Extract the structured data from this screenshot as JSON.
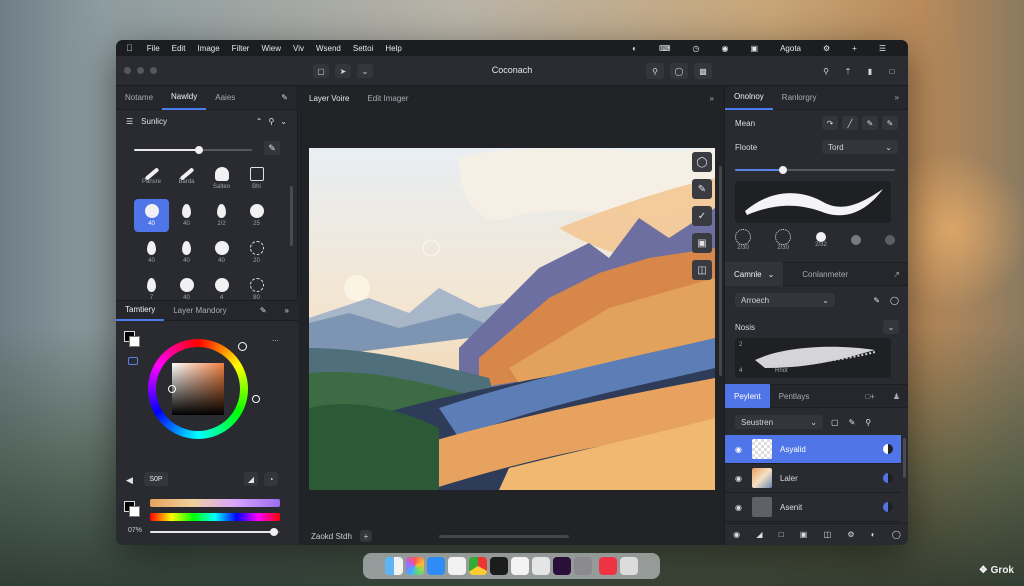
{
  "menubar": {
    "items": [
      "File",
      "Edit",
      "Image",
      "Filter",
      "Wiew",
      "Viv",
      "Wsend",
      "Settoi",
      "Help"
    ],
    "right_label": "Agota"
  },
  "window": {
    "title": "Coconach"
  },
  "left_panel": {
    "tabs": [
      "Notame",
      "Nawldy",
      "Aaies"
    ],
    "active_tab": "Nawldy",
    "brush_section_title": "Sunlicy",
    "brush_size": 0.55,
    "brushes": [
      {
        "label": "Pansre",
        "shape": "stroke"
      },
      {
        "label": "Barda",
        "shape": "stroke"
      },
      {
        "label": "Salteo",
        "shape": "dome"
      },
      {
        "label": "Bhl",
        "shape": "square"
      },
      {
        "label": "40",
        "shape": "round",
        "selected": true
      },
      {
        "label": "40",
        "shape": "drop"
      },
      {
        "label": "2/2",
        "shape": "drop"
      },
      {
        "label": "25",
        "shape": "round"
      },
      {
        "label": "40",
        "shape": "drop"
      },
      {
        "label": "40",
        "shape": "drop"
      },
      {
        "label": "40",
        "shape": "round"
      },
      {
        "label": "20",
        "shape": "ring"
      },
      {
        "label": "7",
        "shape": "drop"
      },
      {
        "label": "40",
        "shape": "round"
      },
      {
        "label": "4",
        "shape": "round"
      },
      {
        "label": "80",
        "shape": "ring"
      }
    ],
    "color_tabs": [
      "Tamtiery",
      "Layer Mandory"
    ],
    "hex_value": "S0P",
    "opacity_label": "07%",
    "opacity": 0.95
  },
  "canvas": {
    "tabs": [
      "Layer Voire",
      "Edit Imager"
    ],
    "active_tab": "Layer Voire",
    "bottom_tab": "Zaokd Stdh"
  },
  "right_panel": {
    "tabs": [
      "Onolnoy",
      "Ranlorgry"
    ],
    "active_tab": "Onolnoy",
    "label_mean": "Mean",
    "label_flow": "Floote",
    "flow_dropdown": "Tord",
    "flow_value": 0.3,
    "brush_dots": [
      "2/30",
      "2/30",
      "2/32",
      "",
      ""
    ],
    "section2_tabs": [
      "Camnle",
      "Conlanmeter"
    ],
    "section2_dropdown": "Arroech",
    "label_nosis": "Nosis",
    "stroke_labels": [
      "2",
      "4",
      "Rnot"
    ],
    "layer_tabs": [
      "Peylent",
      "Pentlays"
    ],
    "layer_dropdown": "Seustren",
    "layers": [
      {
        "name": "Asyalid",
        "selected": true
      },
      {
        "name": "Laler",
        "selected": false
      },
      {
        "name": "Asenit",
        "selected": false
      }
    ]
  },
  "watermark": "Grok"
}
